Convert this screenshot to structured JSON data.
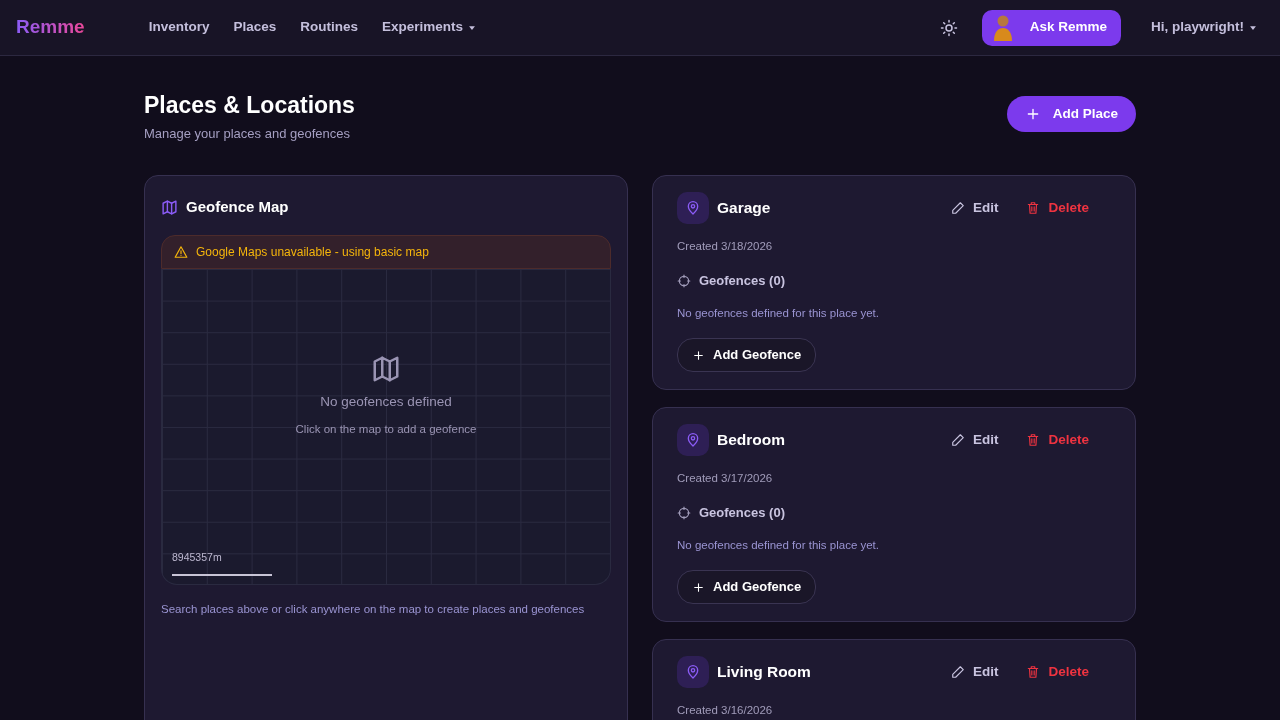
{
  "navbar": {
    "brand": "Remme",
    "links": [
      {
        "label": "Inventory",
        "dropdown": false
      },
      {
        "label": "Places",
        "dropdown": false
      },
      {
        "label": "Routines",
        "dropdown": false
      },
      {
        "label": "Experiments",
        "dropdown": true
      }
    ],
    "ask_button": "Ask Remme",
    "user_menu": "Hi, playwright!"
  },
  "header": {
    "title": "Places & Locations",
    "subtitle": "Manage your places and geofences",
    "add_button": "Add Place"
  },
  "map_panel": {
    "title": "Geofence Map",
    "warning": "Google Maps unavailable - using basic map",
    "empty_title": "No geofences defined",
    "empty_hint": "Click on the map to add a geofence",
    "scale": "8945357m",
    "footer": "Search places above or click anywhere on the map to create places and geofences"
  },
  "places": [
    {
      "name": "Garage",
      "edit": "Edit",
      "delete": "Delete",
      "created": "Created 3/18/2026",
      "geofences_label": "Geofences (0)",
      "empty": "No geofences defined for this place yet.",
      "add_geofence": "Add Geofence"
    },
    {
      "name": "Bedroom",
      "edit": "Edit",
      "delete": "Delete",
      "created": "Created 3/17/2026",
      "geofences_label": "Geofences (0)",
      "empty": "No geofences defined for this place yet.",
      "add_geofence": "Add Geofence"
    },
    {
      "name": "Living Room",
      "edit": "Edit",
      "delete": "Delete",
      "created": "Created 3/16/2026"
    }
  ]
}
